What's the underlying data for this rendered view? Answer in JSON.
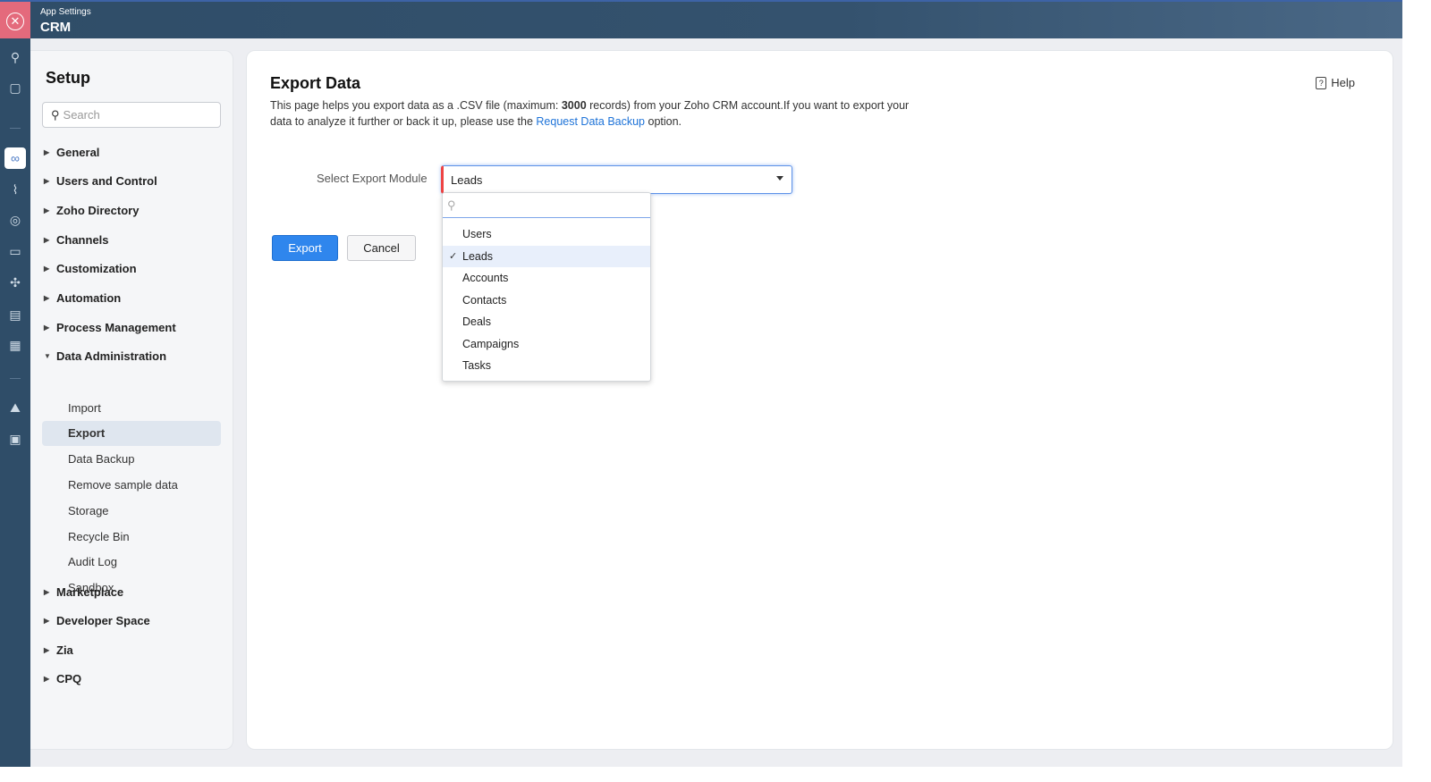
{
  "header": {
    "subtitle": "App Settings",
    "title": "CRM"
  },
  "setup": {
    "title": "Setup",
    "search_placeholder": "Search",
    "items": [
      {
        "label": "General"
      },
      {
        "label": "Users and Control"
      },
      {
        "label": "Zoho Directory"
      },
      {
        "label": "Channels"
      },
      {
        "label": "Customization"
      },
      {
        "label": "Automation"
      },
      {
        "label": "Process Management"
      },
      {
        "label": "Data Administration"
      },
      {
        "label": "Import"
      },
      {
        "label": "Export"
      },
      {
        "label": "Data Backup"
      },
      {
        "label": "Remove sample data"
      },
      {
        "label": "Storage"
      },
      {
        "label": "Recycle Bin"
      },
      {
        "label": "Audit Log"
      },
      {
        "label": "Sandbox"
      },
      {
        "label": "Marketplace"
      },
      {
        "label": "Developer Space"
      },
      {
        "label": "Zia"
      },
      {
        "label": "CPQ"
      }
    ]
  },
  "main": {
    "title": "Export Data",
    "help": "Help",
    "desc_1": "This page helps you export data as a .CSV file (maximum: ",
    "desc_bold": "3000",
    "desc_2": " records) from your Zoho CRM account.If you want to export your data to analyze it further or back it up, please use the ",
    "desc_link": "Request Data Backup",
    "desc_3": " option.",
    "module_label": "Select Export Module",
    "module_value": "Leads",
    "export": "Export",
    "cancel": "Cancel",
    "options": [
      "Users",
      "Leads",
      "Accounts",
      "Contacts",
      "Deals",
      "Campaigns",
      "Tasks"
    ],
    "selected_option": "Leads",
    "check": "✓"
  }
}
